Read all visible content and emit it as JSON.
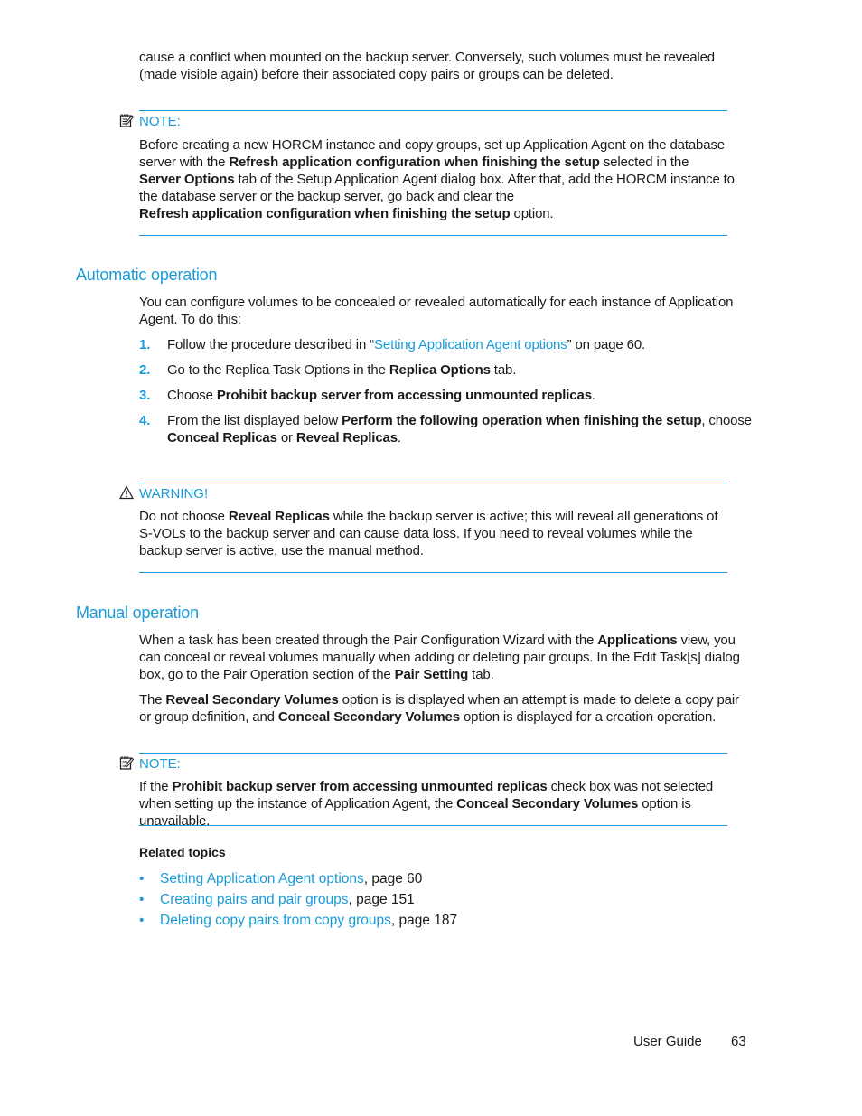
{
  "intro": {
    "line1": "cause a conflict when mounted on the backup server. Conversely, such volumes must be revealed",
    "line2": "(made visible again) before their associated copy pairs or groups can be deleted."
  },
  "note1": {
    "icon": "note-icon",
    "title": "NOTE:",
    "t1": "Before creating a new HORCM instance and copy groups, set up Application Agent on the database server with the ",
    "b1": "Refresh application configuration when finishing the setup",
    "t2": " selected in the ",
    "b2": "Server Options",
    "t3": " tab of the Setup Application Agent dialog box. After that, add the HORCM instance to the database server or the backup server, go back and clear the ",
    "b3": "Refresh application configuration when finishing the setup",
    "t4": " option."
  },
  "automatic": {
    "heading": "Automatic operation",
    "intro": "You can configure volumes to be concealed or revealed automatically for each instance of Application Agent. To do this:",
    "steps": [
      {
        "num": "1.",
        "t1": "Follow the procedure described in “",
        "link": "Setting Application Agent options",
        "t2": "” on page 60."
      },
      {
        "num": "2.",
        "t1": "Go to the Replica Task Options in the ",
        "b1": "Replica Options",
        "t2": " tab."
      },
      {
        "num": "3.",
        "t1": "Choose ",
        "b1": "Prohibit backup server from accessing unmounted replicas",
        "t2": "."
      },
      {
        "num": "4.",
        "t1": "From the list displayed below ",
        "b1": "Perform the following operation when finishing the setup",
        "t2": ", choose ",
        "b2": "Conceal Replicas",
        "t3": " or ",
        "b3": "Reveal Replicas",
        "t4": "."
      }
    ]
  },
  "warning": {
    "icon": "warning-icon",
    "title": "WARNING!",
    "t1": "Do not choose ",
    "b1": "Reveal Replicas",
    "t2": " while the backup server is active; this will reveal all generations of S-VOLs to the backup server and can cause data loss. If you need to reveal volumes while the backup server is active, use the manual method."
  },
  "manual": {
    "heading": "Manual operation",
    "p1": {
      "t1": "When a task has been created through the Pair Configuration Wizard with the ",
      "b1": "Applications",
      "t2": " view, you can conceal or reveal volumes manually when adding or deleting pair groups. In the Edit Task[s] dialog box, go to the Pair Operation section of the ",
      "b2": "Pair Setting",
      "t3": " tab."
    },
    "p2": {
      "t1": "The ",
      "b1": "Reveal Secondary Volumes",
      "t2": " option is is displayed when an attempt is made to delete a copy pair or group definition, and ",
      "b2": "Conceal Secondary Volumes",
      "t3": " option is displayed for a creation operation."
    }
  },
  "note2": {
    "icon": "note-icon",
    "title": "NOTE:",
    "t1": "If the ",
    "b1": "Prohibit backup server from accessing unmounted replicas",
    "t2": " check box was not selected when setting up the instance of Application Agent, the ",
    "b2": "Conceal Secondary Volumes",
    "t3": " option is unavailable."
  },
  "related": {
    "title": "Related topics",
    "items": [
      {
        "link": "Setting Application Agent options",
        "page": ", page 60"
      },
      {
        "link": "Creating pairs and pair groups",
        "page": ", page 151"
      },
      {
        "link": "Deleting copy pairs from copy groups",
        "page": ", page 187"
      }
    ]
  },
  "footer": {
    "guide": "User Guide",
    "page_number": "63"
  },
  "colors": {
    "accent": "#1a9bd7",
    "text": "#1a1a1a"
  }
}
